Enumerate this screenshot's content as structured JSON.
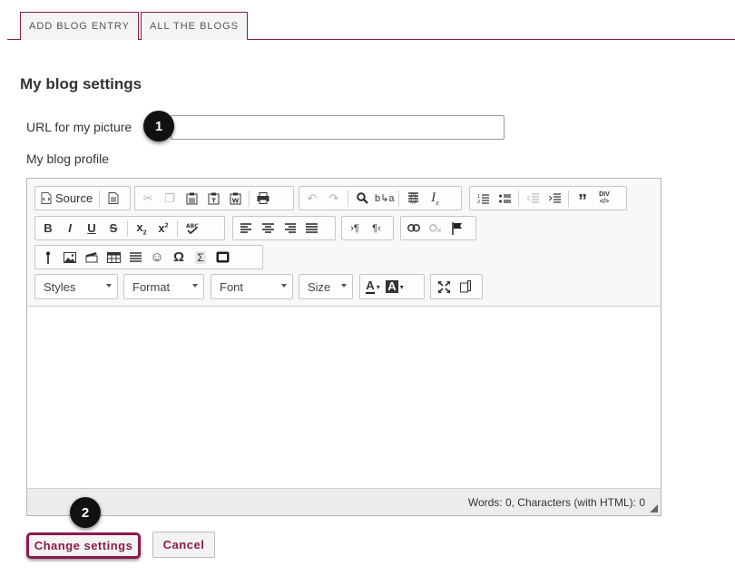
{
  "tabs": {
    "add_entry": "ADD BLOG ENTRY",
    "all_blogs": "ALL THE BLOGS"
  },
  "page": {
    "title": "My blog settings"
  },
  "form": {
    "url_label": "URL for my picture",
    "url_value": "",
    "profile_label": "My blog profile"
  },
  "callouts": {
    "one": "1",
    "two": "2"
  },
  "editor": {
    "source_label": "Source",
    "combos": {
      "styles": "Styles",
      "format": "Format",
      "font": "Font",
      "size": "Size"
    },
    "status": "Words: 0, Characters (with HTML): 0",
    "content": ""
  },
  "buttons": {
    "change": "Change settings",
    "cancel": "Cancel"
  },
  "colors": {
    "accent": "#8b1a4d",
    "callout": "#111111"
  }
}
